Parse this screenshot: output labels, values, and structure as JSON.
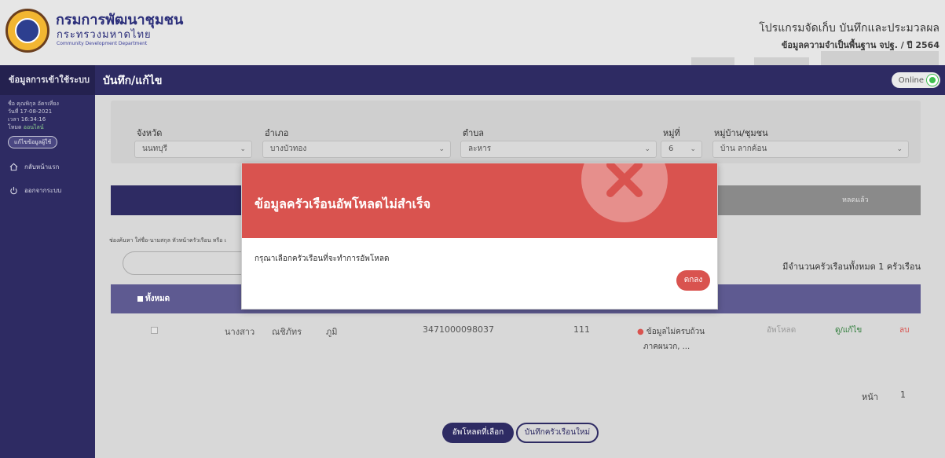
{
  "header": {
    "org_name_th": "กรมการพัฒนาชุมชน",
    "org_ministry": "กระทรวงมหาดไทย",
    "org_name_en": "Community Development Department",
    "program_title": "โปรแกรมจัดเก็บ บันทึกและประมวลผล",
    "program_subtitle": "ข้อมูลความจำเป็นพื้นฐาน จปฐ. / ปี 2564"
  },
  "sidebar": {
    "title": "ข้อมูลการเข้าใช้ระบบ",
    "user_name": "ชื่อ คุณพิกุล อัครเที่ยง",
    "date": "วันที่ 17-08-2021",
    "time": "เวลา 16:34:16",
    "mode_label": "โหมด",
    "mode_value": "ออนไลน์",
    "edit_button": "แก้ไขข้อมูลผู้ใช้",
    "nav_home": "กลับหน้าแรก",
    "nav_logout": "ออกจากระบบ"
  },
  "topbar": {
    "page_title": "บันทึก/แก้ไข",
    "status": "Online"
  },
  "filters": {
    "province_label": "จังหวัด",
    "province_value": "นนทบุรี",
    "district_label": "อำเภอ",
    "district_value": "บางบัวทอง",
    "subdistrict_label": "ตำบล",
    "subdistrict_value": "ละหาร",
    "moo_label": "หมู่ที่",
    "moo_value": "6",
    "village_label": "หมู่บ้าน/ชุมชน",
    "village_value": "บ้าน ลากค้อน"
  },
  "tabs": {
    "uploaded_suffix": "หลดแล้ว"
  },
  "search": {
    "help_text": "ช่องค้นหา ใส่ชื่อ-นามสกุล หัวหน้าครัวเรือน หรือ เ"
  },
  "summary": {
    "total_households": "มีจำนวนครัวเรือนทั้งหมด 1 ครัวเรือน"
  },
  "table": {
    "select_all_label": "ทั้งหมด",
    "rows": [
      {
        "title": "นางสาว",
        "first_name": "ณชิภัทร",
        "last_name": "ภูมิ",
        "id_number": "3471000098037",
        "house_no": "111",
        "status_line1": "ข้อมูลไม่ครบถ้วน",
        "status_line2": "ภาคผนวก, ...",
        "upload": "อัพโหลด",
        "view_edit": "ดู/แก้ไข",
        "delete": "ลบ"
      }
    ]
  },
  "pagination": {
    "page_label": "หน้า",
    "page_number": "1"
  },
  "actions": {
    "upload_selected": "อัพโหลดที่เลือก",
    "new_household": "บันทึกครัวเรือนใหม่"
  },
  "modal": {
    "title": "ข้อมูลครัวเรือนอัพโหลดไม่สำเร็จ",
    "message": "กรุณาเลือกครัวเรือนที่จะทำการอัพโหลด",
    "ok_button": "ตกลง"
  },
  "colors": {
    "brand_purple": "#2e2b63",
    "error_red": "#d9534f",
    "online_green": "#3fbf4f"
  },
  "icons": [
    "home-icon",
    "power-icon",
    "close-x-icon",
    "chevron-down-icon"
  ]
}
